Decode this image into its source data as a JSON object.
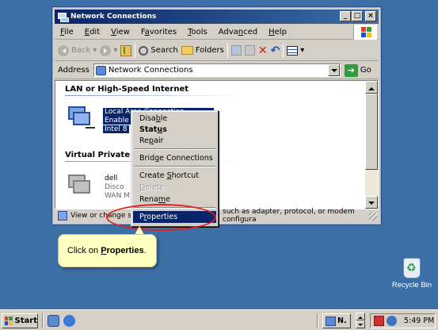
{
  "window": {
    "title": "Network Connections",
    "controls": {
      "minimize": "_",
      "maximize": "□",
      "close": "×"
    }
  },
  "menubar": {
    "items": [
      {
        "label": "File",
        "access": "F",
        "rest": "ile"
      },
      {
        "label": "Edit",
        "access": "E",
        "rest": "dit"
      },
      {
        "label": "View",
        "access": "V",
        "rest": "iew"
      },
      {
        "label": "Favorites",
        "access": "a",
        "pre": "F",
        "rest": "vorites"
      },
      {
        "label": "Tools",
        "access": "T",
        "rest": "ools"
      },
      {
        "label": "Advanced",
        "access": "n",
        "pre": "Adva",
        "rest": "ced"
      },
      {
        "label": "Help",
        "access": "H",
        "rest": "elp"
      }
    ]
  },
  "toolbar": {
    "back": "Back",
    "search": "Search",
    "folders": "Folders"
  },
  "address": {
    "label": "Address",
    "value": "Network Connections",
    "go": "Go"
  },
  "content": {
    "sections": [
      {
        "title": "LAN or High-Speed Internet"
      },
      {
        "title": "Virtual Private N"
      }
    ],
    "connections": [
      {
        "name": "Local Area Connection",
        "status": "Enable",
        "device": "Intel 8"
      },
      {
        "name": "dell",
        "status": "Disco",
        "device": "WAN M"
      }
    ]
  },
  "statusbar": {
    "text": "View or change s",
    "text_right": "such as adapter, protocol, or modem configura"
  },
  "context_menu": {
    "items": [
      {
        "label": "Disable",
        "underline": "b",
        "pre": "Disa",
        "rest": "le",
        "state": "normal"
      },
      {
        "label": "Status",
        "underline": "u",
        "pre": "Stat",
        "rest": "s",
        "state": "bold"
      },
      {
        "label": "Repair",
        "underline": "p",
        "pre": "Re",
        "rest": "air",
        "state": "normal"
      },
      {
        "label": "Bridge Connections",
        "underline": "g",
        "pre": "Brid",
        "rest": "e Connections",
        "state": "normal"
      },
      {
        "label": "Create Shortcut",
        "underline": "S",
        "pre": "Create ",
        "rest": "hortcut",
        "state": "normal"
      },
      {
        "label": "Delete",
        "underline": "D",
        "pre": "",
        "rest": "elete",
        "state": "disabled"
      },
      {
        "label": "Rename",
        "underline": "m",
        "pre": "Rena",
        "rest": "e",
        "state": "normal"
      },
      {
        "label": "Properties",
        "underline": "r",
        "pre": "P",
        "rest": "operties",
        "state": "highlight"
      }
    ]
  },
  "callout": {
    "prefix": "Click on ",
    "target_first": "P",
    "target_rest": "roperties",
    "suffix": "."
  },
  "desktop": {
    "recycle_bin": "Recycle Bin"
  },
  "taskbar": {
    "start": "Start",
    "task_label": "N.",
    "clock": "5:49 PM"
  }
}
